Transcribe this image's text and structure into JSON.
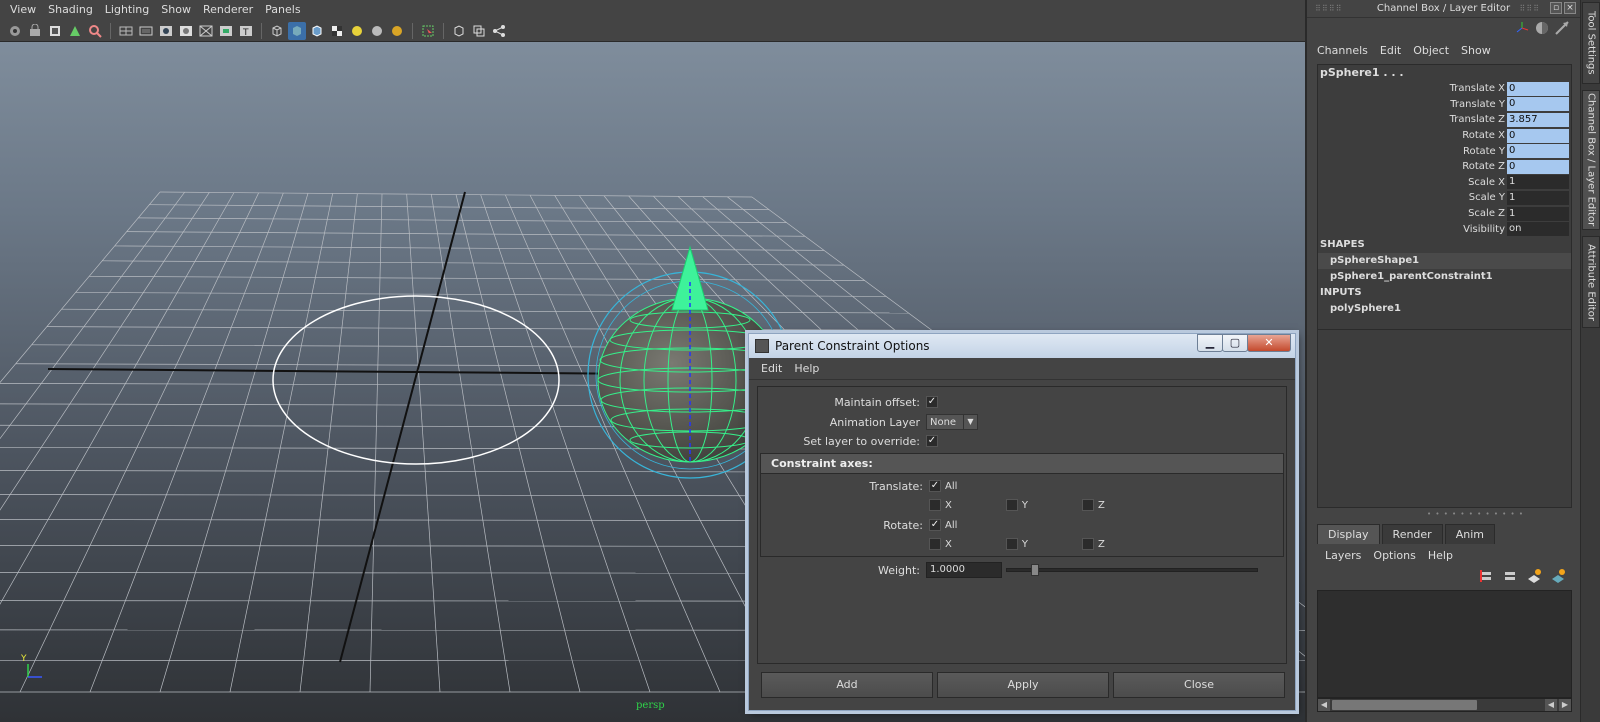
{
  "viewport": {
    "menus": [
      "View",
      "Shading",
      "Lighting",
      "Show",
      "Renderer",
      "Panels"
    ],
    "camera_label": "persp",
    "axis_label": "Y"
  },
  "channel_box": {
    "header_title": "Channel Box / Layer Editor",
    "menus": [
      "Channels",
      "Edit",
      "Object",
      "Show"
    ],
    "object_name": "pSphere1 . . .",
    "attributes": [
      {
        "label": "Translate X",
        "value": "0",
        "keyed": true
      },
      {
        "label": "Translate Y",
        "value": "0",
        "keyed": true
      },
      {
        "label": "Translate Z",
        "value": "3.857",
        "keyed": true
      },
      {
        "label": "Rotate X",
        "value": "0",
        "keyed": true
      },
      {
        "label": "Rotate Y",
        "value": "0",
        "keyed": true
      },
      {
        "label": "Rotate Z",
        "value": "0",
        "keyed": true
      },
      {
        "label": "Scale X",
        "value": "1",
        "keyed": false
      },
      {
        "label": "Scale Y",
        "value": "1",
        "keyed": false
      },
      {
        "label": "Scale Z",
        "value": "1",
        "keyed": false
      },
      {
        "label": "Visibility",
        "value": "on",
        "keyed": false
      }
    ],
    "shapes_label": "SHAPES",
    "shapes": [
      "pSphereShape1",
      "pSphere1_parentConstraint1"
    ],
    "inputs_label": "INPUTS",
    "inputs": [
      "polySphere1"
    ]
  },
  "layer_editor": {
    "tabs": [
      "Display",
      "Render",
      "Anim"
    ],
    "menus": [
      "Layers",
      "Options",
      "Help"
    ]
  },
  "side_tabs": [
    "Tool Settings",
    "Channel Box / Layer Editor",
    "Attribute Editor"
  ],
  "dialog": {
    "title": "Parent Constraint Options",
    "menus": [
      "Edit",
      "Help"
    ],
    "maintain_offset_label": "Maintain offset:",
    "animation_layer_label": "Animation Layer",
    "animation_layer_value": "None",
    "set_layer_label": "Set layer to override:",
    "constraint_axes_label": "Constraint axes:",
    "translate_label": "Translate:",
    "rotate_label": "Rotate:",
    "all_label": "All",
    "axis_x": "X",
    "axis_y": "Y",
    "axis_z": "Z",
    "weight_label": "Weight:",
    "weight_value": "1.0000",
    "weight_fraction": 0.1,
    "buttons": {
      "add": "Add",
      "apply": "Apply",
      "close": "Close"
    }
  }
}
